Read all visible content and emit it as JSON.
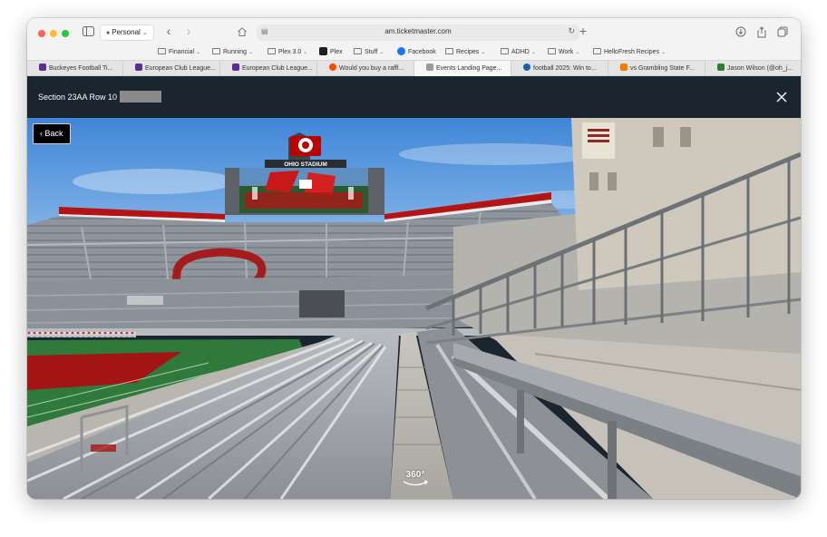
{
  "browser": {
    "profile_label": "Personal",
    "url": "am.ticketmaster.com"
  },
  "bookmarks": [
    {
      "label": "Financial",
      "type": "folder"
    },
    {
      "label": "Running",
      "type": "folder"
    },
    {
      "label": "Plex 3.0",
      "type": "folder"
    },
    {
      "label": "Plex",
      "type": "link",
      "color": "#1f1f1f"
    },
    {
      "label": "Stuff",
      "type": "folder"
    },
    {
      "label": "Facebook",
      "type": "link",
      "color": "#1877f2"
    },
    {
      "label": "Recipes",
      "type": "folder"
    },
    {
      "label": "ADHD",
      "type": "folder"
    },
    {
      "label": "Work",
      "type": "folder"
    },
    {
      "label": "HelloFresh Recipes",
      "type": "folder"
    }
  ],
  "tabs": [
    {
      "label": "Buckeyes Football Ti...",
      "color": "#5b2d8e"
    },
    {
      "label": "European Club League...",
      "color": "#5b2d8e"
    },
    {
      "label": "European Club League...",
      "color": "#5b2d8e"
    },
    {
      "label": "Would you buy a raffl...",
      "color": "#ff4500"
    },
    {
      "label": "Events Landing Page...",
      "color": "#9a9a9a",
      "active": true
    },
    {
      "label": "football 2025: Win to...",
      "color": "#1a5fb4"
    },
    {
      "label": "vs Grambling State F...",
      "color": "#f57c00"
    },
    {
      "label": "Jason Wilson (@oh_j...",
      "color": "#2e7d32"
    }
  ],
  "seat_view": {
    "title": "Section 23AA Row 10",
    "back_label": "Back",
    "badge_360": "360°",
    "scoreboard_label": "OHIO STADIUM"
  },
  "colors": {
    "header_bg": "#1b2530",
    "scarlet": "#bb0000",
    "sky": "#4a8fd6",
    "field": "#2f7a3a"
  }
}
